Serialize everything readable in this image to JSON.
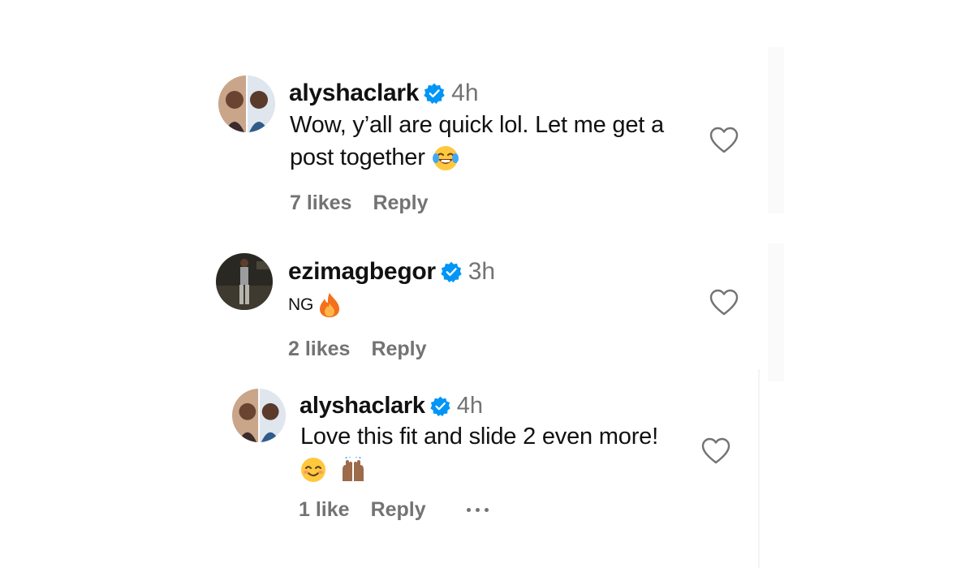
{
  "comments": [
    {
      "username": "alyshaclark",
      "verified": true,
      "time": "4h",
      "text": "Wow, y’all are quick lol. Let me get a post together",
      "emojis": [
        "face-with-tears-of-joy"
      ],
      "likes": "7 likes",
      "reply_label": "Reply"
    },
    {
      "username": "ezimagbegor",
      "verified": true,
      "time": "3h",
      "text": "NG",
      "emojis": [
        "fire"
      ],
      "likes": "2 likes",
      "reply_label": "Reply"
    },
    {
      "username": "alyshaclark",
      "verified": true,
      "time": "4h",
      "text": "Love this fit and slide 2 even more!",
      "emojis": [
        "smiling-face-with-smiling-eyes",
        "raising-hands"
      ],
      "likes": "1 like",
      "reply_label": "Reply",
      "has_more_menu": true
    }
  ],
  "icons": {
    "verified": "verified-badge-icon",
    "like": "heart-icon",
    "more": "more-options-icon"
  },
  "colors": {
    "verified_blue": "#0095f6",
    "meta_gray": "#737373",
    "text": "#111111"
  }
}
